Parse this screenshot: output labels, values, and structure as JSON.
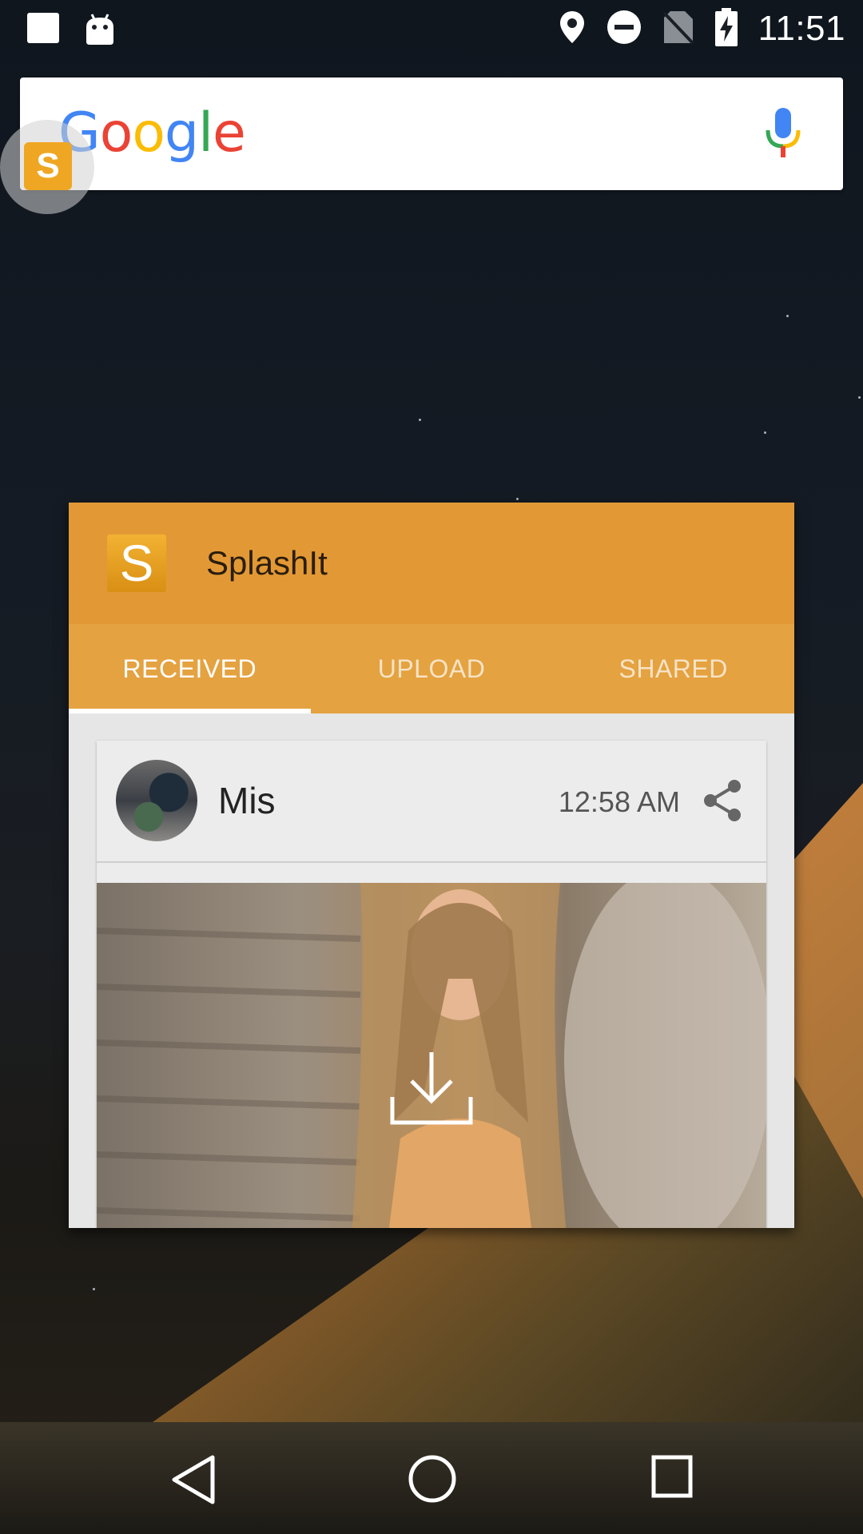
{
  "status_bar": {
    "time": "11:51",
    "left_icons": [
      "notification-square-icon",
      "android-icon"
    ],
    "right_icons": [
      "location-icon",
      "do-not-disturb-icon",
      "no-sim-icon",
      "battery-charging-icon"
    ]
  },
  "search_widget": {
    "logo": "Google",
    "mic_icon": "mic-icon"
  },
  "floating_bubble": {
    "letter": "S"
  },
  "recent_app": {
    "app_icon_letter": "S",
    "title": "SplashIt",
    "tabs": [
      {
        "label": "RECEIVED",
        "active": true
      },
      {
        "label": "UPLOAD",
        "active": false
      },
      {
        "label": "SHARED",
        "active": false
      }
    ],
    "post": {
      "username": "Mis",
      "time": "12:58 AM",
      "share_icon": "share-icon",
      "download_icon": "download-icon"
    }
  },
  "navigation": {
    "buttons": [
      "back-icon",
      "home-icon",
      "recents-icon"
    ]
  },
  "colors": {
    "header": "#e29935",
    "tabs": "#e4a240",
    "accent": "#efa723"
  }
}
